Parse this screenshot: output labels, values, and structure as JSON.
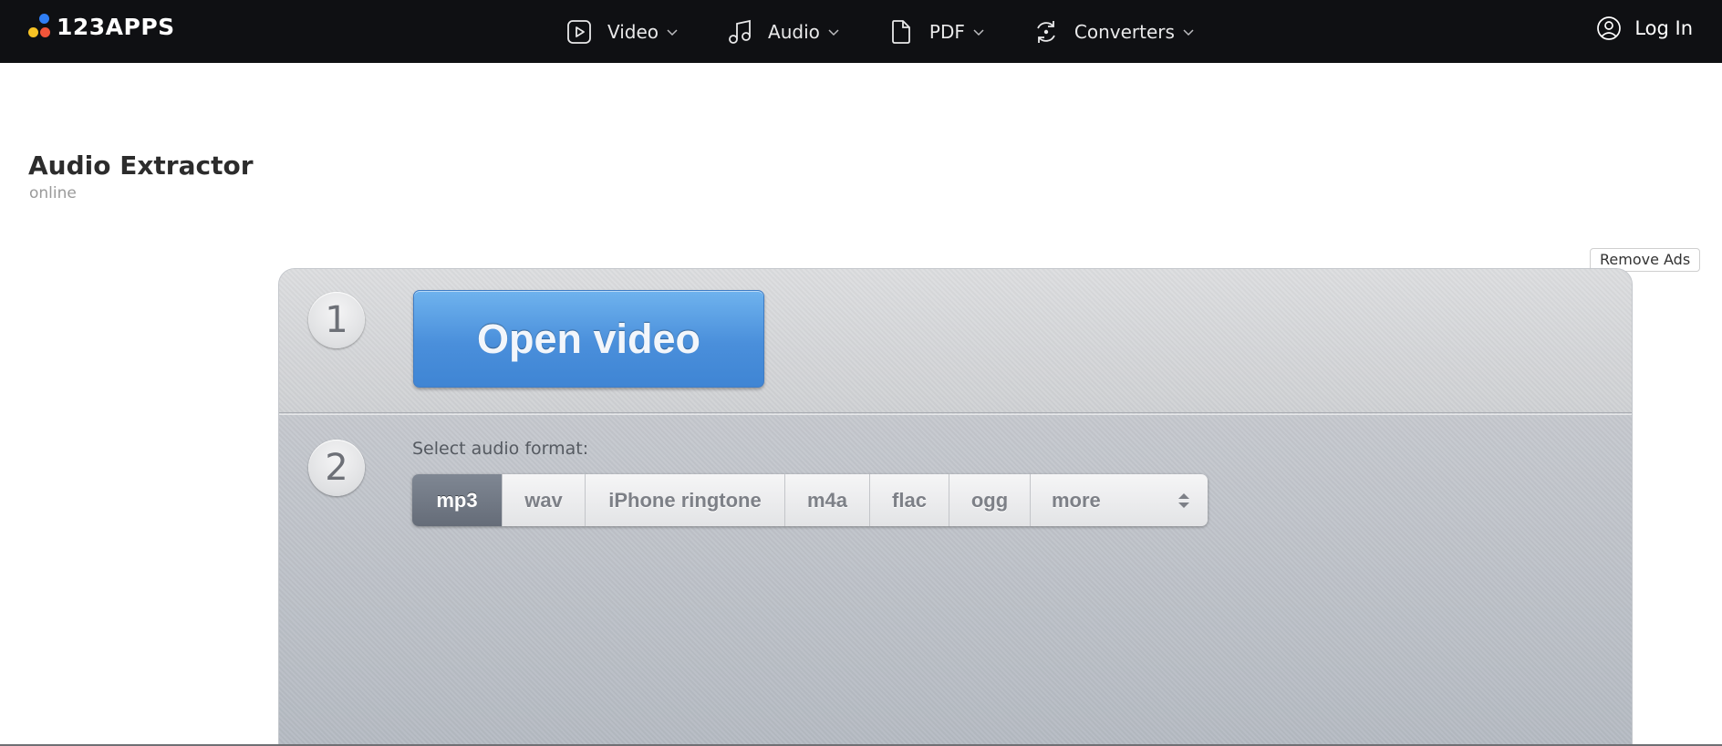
{
  "header": {
    "logo_text": "123APPS",
    "nav": [
      {
        "label": "Video",
        "icon": "play-square-icon"
      },
      {
        "label": "Audio",
        "icon": "music-note-icon"
      },
      {
        "label": "PDF",
        "icon": "document-icon"
      },
      {
        "label": "Converters",
        "icon": "refresh-icon"
      }
    ],
    "login_label": "Log In"
  },
  "page": {
    "title": "Audio Extractor",
    "subtitle": "online",
    "remove_ads": "Remove Ads"
  },
  "tool": {
    "step1_number": "1",
    "open_button": "Open video",
    "step2_number": "2",
    "format_label": "Select audio format:",
    "formats": [
      "mp3",
      "wav",
      "iPhone ringtone",
      "m4a",
      "flac",
      "ogg",
      "more"
    ],
    "selected_format": "mp3"
  },
  "colors": {
    "topbar": "#0f1013",
    "button_blue": "#4a8fdb",
    "active_format": "#656c78",
    "logo_blue": "#2f7ef5",
    "logo_yellow": "#f7c325",
    "logo_red": "#f2553a"
  }
}
